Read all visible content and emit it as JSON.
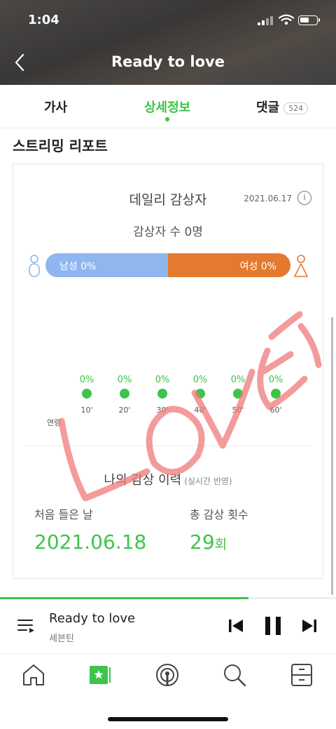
{
  "status_bar": {
    "time": "1:04"
  },
  "header": {
    "title": "Ready to love"
  },
  "tabs": [
    {
      "label": "가사"
    },
    {
      "label": "상세정보"
    },
    {
      "label": "댓글",
      "badge": "524"
    }
  ],
  "section": {
    "title": "스트리밍 리포트"
  },
  "daily": {
    "title": "데일리 감상자",
    "date": "2021.06.17",
    "info_symbol": "i",
    "listener_count": "감상자 수 0명",
    "male_label": "남성 0%",
    "female_label": "여성 0%",
    "male_ratio": 0.5,
    "male_color": "#8fb6ef",
    "female_color": "#e47a2e",
    "age_axis_label": "연령",
    "ages": [
      {
        "tick": "10'",
        "pct": "0%"
      },
      {
        "tick": "20'",
        "pct": "0%"
      },
      {
        "tick": "30'",
        "pct": "0%"
      },
      {
        "tick": "40'",
        "pct": "0%"
      },
      {
        "tick": "50'",
        "pct": "0%"
      },
      {
        "tick": "60'",
        "pct": "0%"
      }
    ]
  },
  "history": {
    "title": "나의 감상 이력",
    "subtitle": "(실시간 반영)",
    "first_label": "처음 들은 날",
    "first_value": "2021.06.18",
    "total_label": "총 감상 횟수",
    "total_value": "29",
    "total_unit": "회"
  },
  "watermark_text": "LOVE",
  "player": {
    "title": "Ready to love",
    "artist": "세븐틴",
    "progress": 0.74
  },
  "bottom_nav": [
    "home-icon",
    "my-music-icon",
    "podcast-icon",
    "search-icon",
    "library-icon"
  ],
  "colors": {
    "accent": "#3ec44a"
  }
}
